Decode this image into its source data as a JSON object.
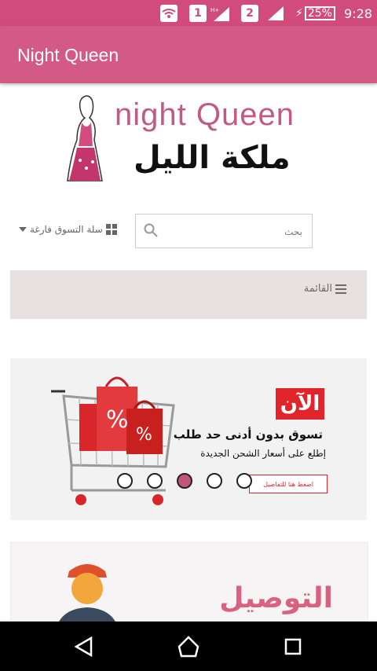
{
  "status_bar": {
    "sim1": "1",
    "network_type": "H+",
    "sim2": "2",
    "battery": "25%",
    "time": "9:28"
  },
  "app_bar": {
    "title": "Night Queen"
  },
  "logo": {
    "english": "night Queen",
    "arabic": "ملكة الليل"
  },
  "header": {
    "cart_label": "سلة التسوق فارغة",
    "search_placeholder": "بحث"
  },
  "menu": {
    "label": "القائمة"
  },
  "banner": {
    "badge": "الآن",
    "headline": "تسوق بدون أدنى حد طلب",
    "subline": "إطلع على أسعار الشحن الجديدة",
    "button": "اضغط هنا للتفاصيل",
    "slides": 5,
    "active_slide": 3
  },
  "banner2": {
    "title": "التوصيل"
  },
  "colors": {
    "accent": "#d35a84",
    "status": "#d14c7a",
    "menu_bg": "#e7e1e1",
    "active_dot": "#c0567c"
  },
  "icons": [
    "wifi-icon",
    "signal-icon",
    "battery-icon",
    "search-icon",
    "grid-icon",
    "menu-icon",
    "back-icon",
    "home-icon",
    "recents-icon"
  ]
}
